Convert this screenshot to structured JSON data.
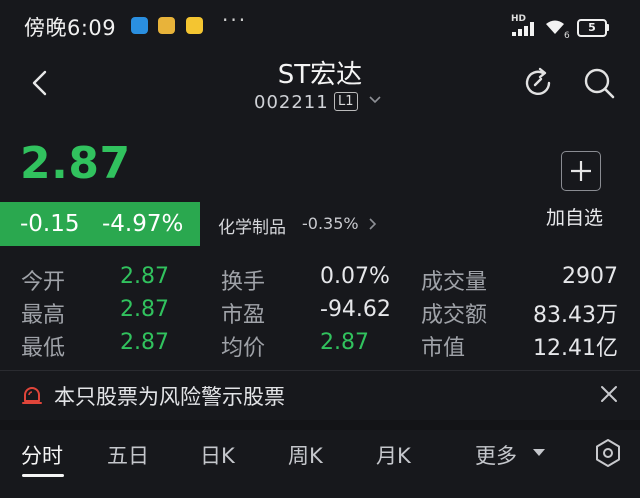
{
  "status_bar": {
    "time": "傍晚6:09",
    "dots": "···",
    "network": "HD",
    "wifi_badge": "6",
    "battery": "5",
    "icons": [
      "app-notification-icon",
      "app-notification-icon-2",
      "app-notification-icon-3"
    ]
  },
  "header": {
    "title": "ST宏达",
    "code": "002211",
    "level": "L1"
  },
  "quote": {
    "price": "2.87",
    "change": "-0.15",
    "change_pct": "-4.97%",
    "sector_name": "化学制品",
    "sector_pct": "-0.35%",
    "add_label": "加自选"
  },
  "stats": [
    {
      "label": "今开",
      "value": "2.87",
      "green": true
    },
    {
      "label": "换手",
      "value": "0.07%",
      "green": false
    },
    {
      "label": "成交量",
      "value": "2907",
      "green": false
    },
    {
      "label": "最高",
      "value": "2.87",
      "green": true
    },
    {
      "label": "市盈",
      "value": "-94.62",
      "green": false
    },
    {
      "label": "成交额",
      "value": "83.43万",
      "green": false
    },
    {
      "label": "最低",
      "value": "2.87",
      "green": true
    },
    {
      "label": "均价",
      "value": "2.87",
      "green": true
    },
    {
      "label": "市值",
      "value": "12.41亿",
      "green": false
    }
  ],
  "warning": {
    "text": "本只股票为风险警示股票"
  },
  "tabs": [
    {
      "label": "分时",
      "active": true
    },
    {
      "label": "五日",
      "active": false
    },
    {
      "label": "日K",
      "active": false
    },
    {
      "label": "周K",
      "active": false
    },
    {
      "label": "月K",
      "active": false
    },
    {
      "label": "更多",
      "active": false
    }
  ],
  "colors": {
    "background": "#17181c",
    "down_green": "#31c25e",
    "badge_green": "#2aa84f",
    "warning_red": "#e0453a"
  }
}
